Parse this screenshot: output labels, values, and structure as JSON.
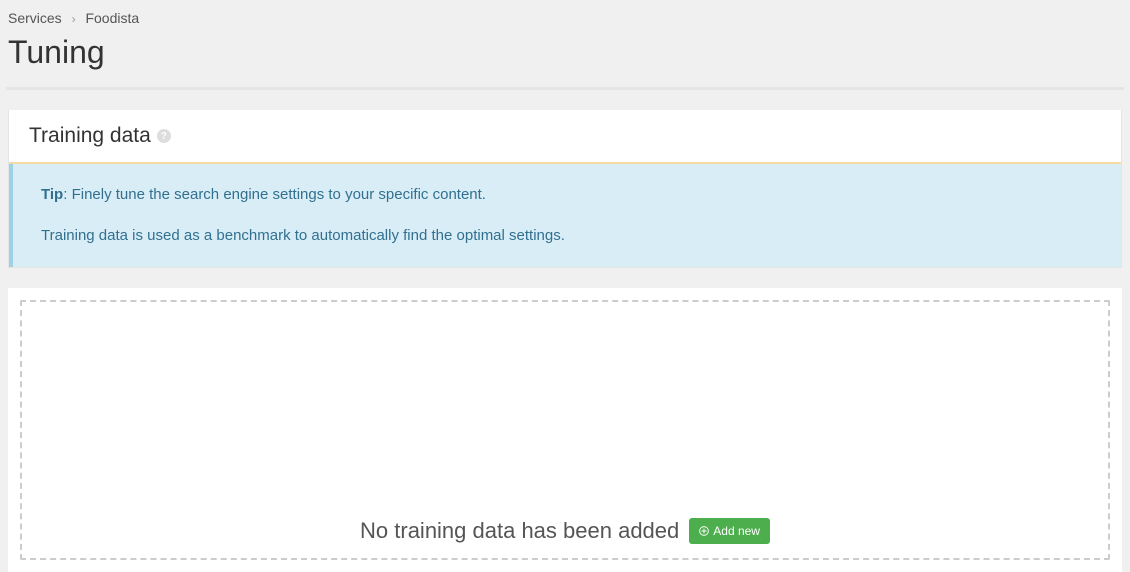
{
  "breadcrumb": {
    "parent": "Services",
    "current": "Foodista"
  },
  "pageTitle": "Tuning",
  "panel": {
    "heading": "Training data",
    "tip": {
      "label": "Tip",
      "line1": ": Finely tune the search engine settings to your specific content.",
      "line2": "Training data is used as a benchmark to automatically find the optimal settings."
    }
  },
  "emptyState": {
    "message": "No training data has been added",
    "buttonLabel": "Add new"
  }
}
